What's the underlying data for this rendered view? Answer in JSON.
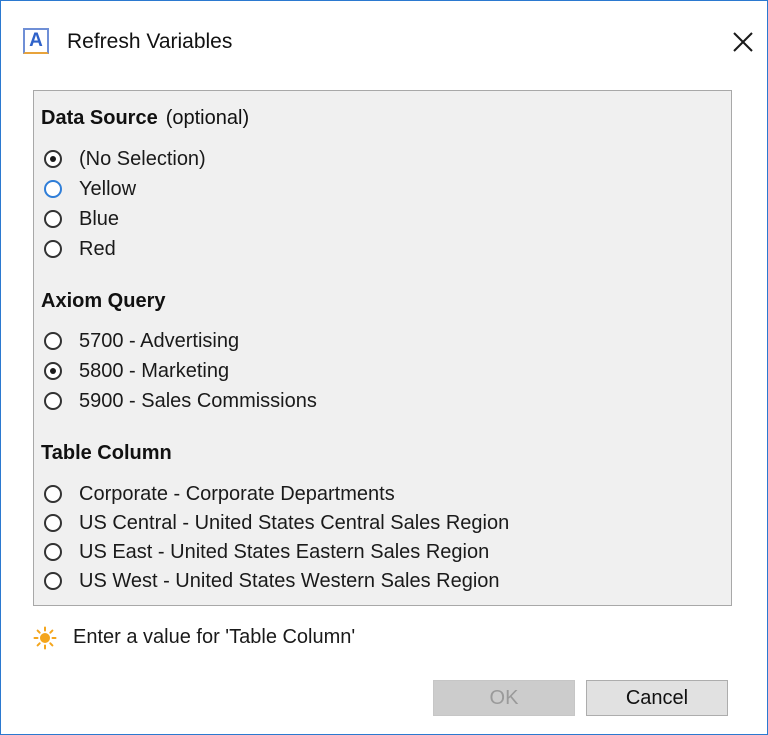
{
  "window": {
    "title": "Refresh Variables",
    "app_icon_letter": "A"
  },
  "sections": {
    "data_source": {
      "title": "Data Source",
      "optional_text": "(optional)",
      "options": [
        {
          "label": "(No Selection)",
          "selected": true
        },
        {
          "label": "Yellow",
          "selected": false
        },
        {
          "label": "Blue",
          "selected": false
        },
        {
          "label": "Red",
          "selected": false
        }
      ]
    },
    "axiom_query": {
      "title": "Axiom Query",
      "options": [
        {
          "label": "5700 - Advertising",
          "selected": false
        },
        {
          "label": "5800 - Marketing",
          "selected": true
        },
        {
          "label": "5900 - Sales Commissions",
          "selected": false
        }
      ]
    },
    "table_column": {
      "title": "Table Column",
      "options": [
        {
          "label": "Corporate - Corporate Departments",
          "selected": false
        },
        {
          "label": "US Central - United States Central Sales Region",
          "selected": false
        },
        {
          "label": "US East - United States Eastern Sales Region",
          "selected": false
        },
        {
          "label": "US West - United States Western Sales Region",
          "selected": false
        }
      ]
    }
  },
  "validation": {
    "message": "Enter a value for 'Table Column'",
    "icon": "sun-icon"
  },
  "buttons": {
    "ok_label": "OK",
    "cancel_label": "Cancel"
  },
  "colors": {
    "window_border": "#2b79d0",
    "panel_background": "#f0f0f0",
    "focused_radio": "#2f7ed8",
    "warning_icon": "#f4a51c"
  }
}
